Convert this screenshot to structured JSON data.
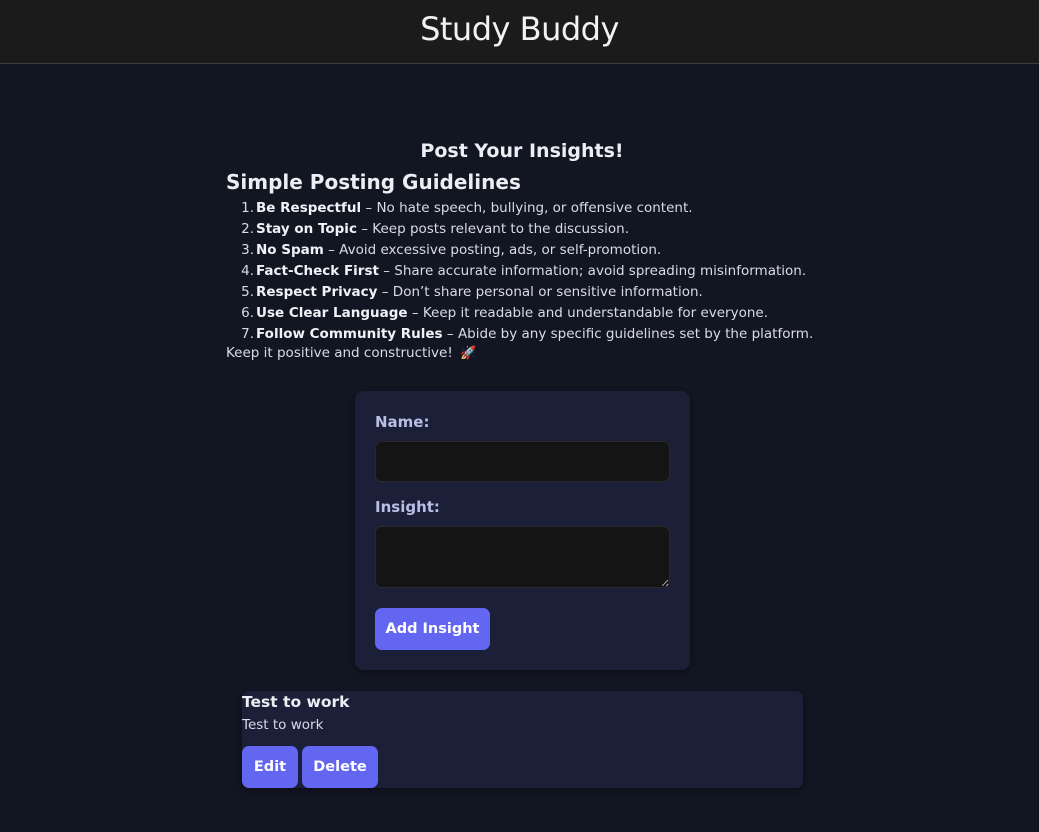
{
  "app": {
    "title": "Study Buddy"
  },
  "main": {
    "heading": "Post Your Insights!",
    "guidelines_title": "Simple Posting Guidelines",
    "guidelines": [
      {
        "num": "1",
        "bold": "Be Respectful",
        "text": " – No hate speech, bullying, or offensive content."
      },
      {
        "num": "2",
        "bold": "Stay on Topic",
        "text": " – Keep posts relevant to the discussion."
      },
      {
        "num": "3",
        "bold": "No Spam",
        "text": " – Avoid excessive posting, ads, or self-promotion."
      },
      {
        "num": "4",
        "bold": "Fact-Check First",
        "text": " – Share accurate information; avoid spreading misinformation."
      },
      {
        "num": "5",
        "bold": "Respect Privacy",
        "text": " – Don’t share personal or sensitive information."
      },
      {
        "num": "6",
        "bold": "Use Clear Language",
        "text": " – Keep it readable and understandable for everyone."
      },
      {
        "num": "7",
        "bold": "Follow Community Rules",
        "text": " – Abide by any specific guidelines set by the platform."
      }
    ],
    "closing": "Keep it positive and constructive!",
    "closing_icon": "🚀"
  },
  "form": {
    "name_label": "Name:",
    "name_value": "",
    "insight_label": "Insight:",
    "insight_value": "",
    "submit_label": "Add Insight"
  },
  "posts": [
    {
      "title": "Test to work",
      "body": "Test to work",
      "edit_label": "Edit",
      "delete_label": "Delete"
    }
  ],
  "colors": {
    "page_bg": "#121522",
    "header_bg": "#1b1b1b",
    "card_bg": "#1b1f38",
    "accent": "#6366f1",
    "input_bg": "#141414"
  }
}
